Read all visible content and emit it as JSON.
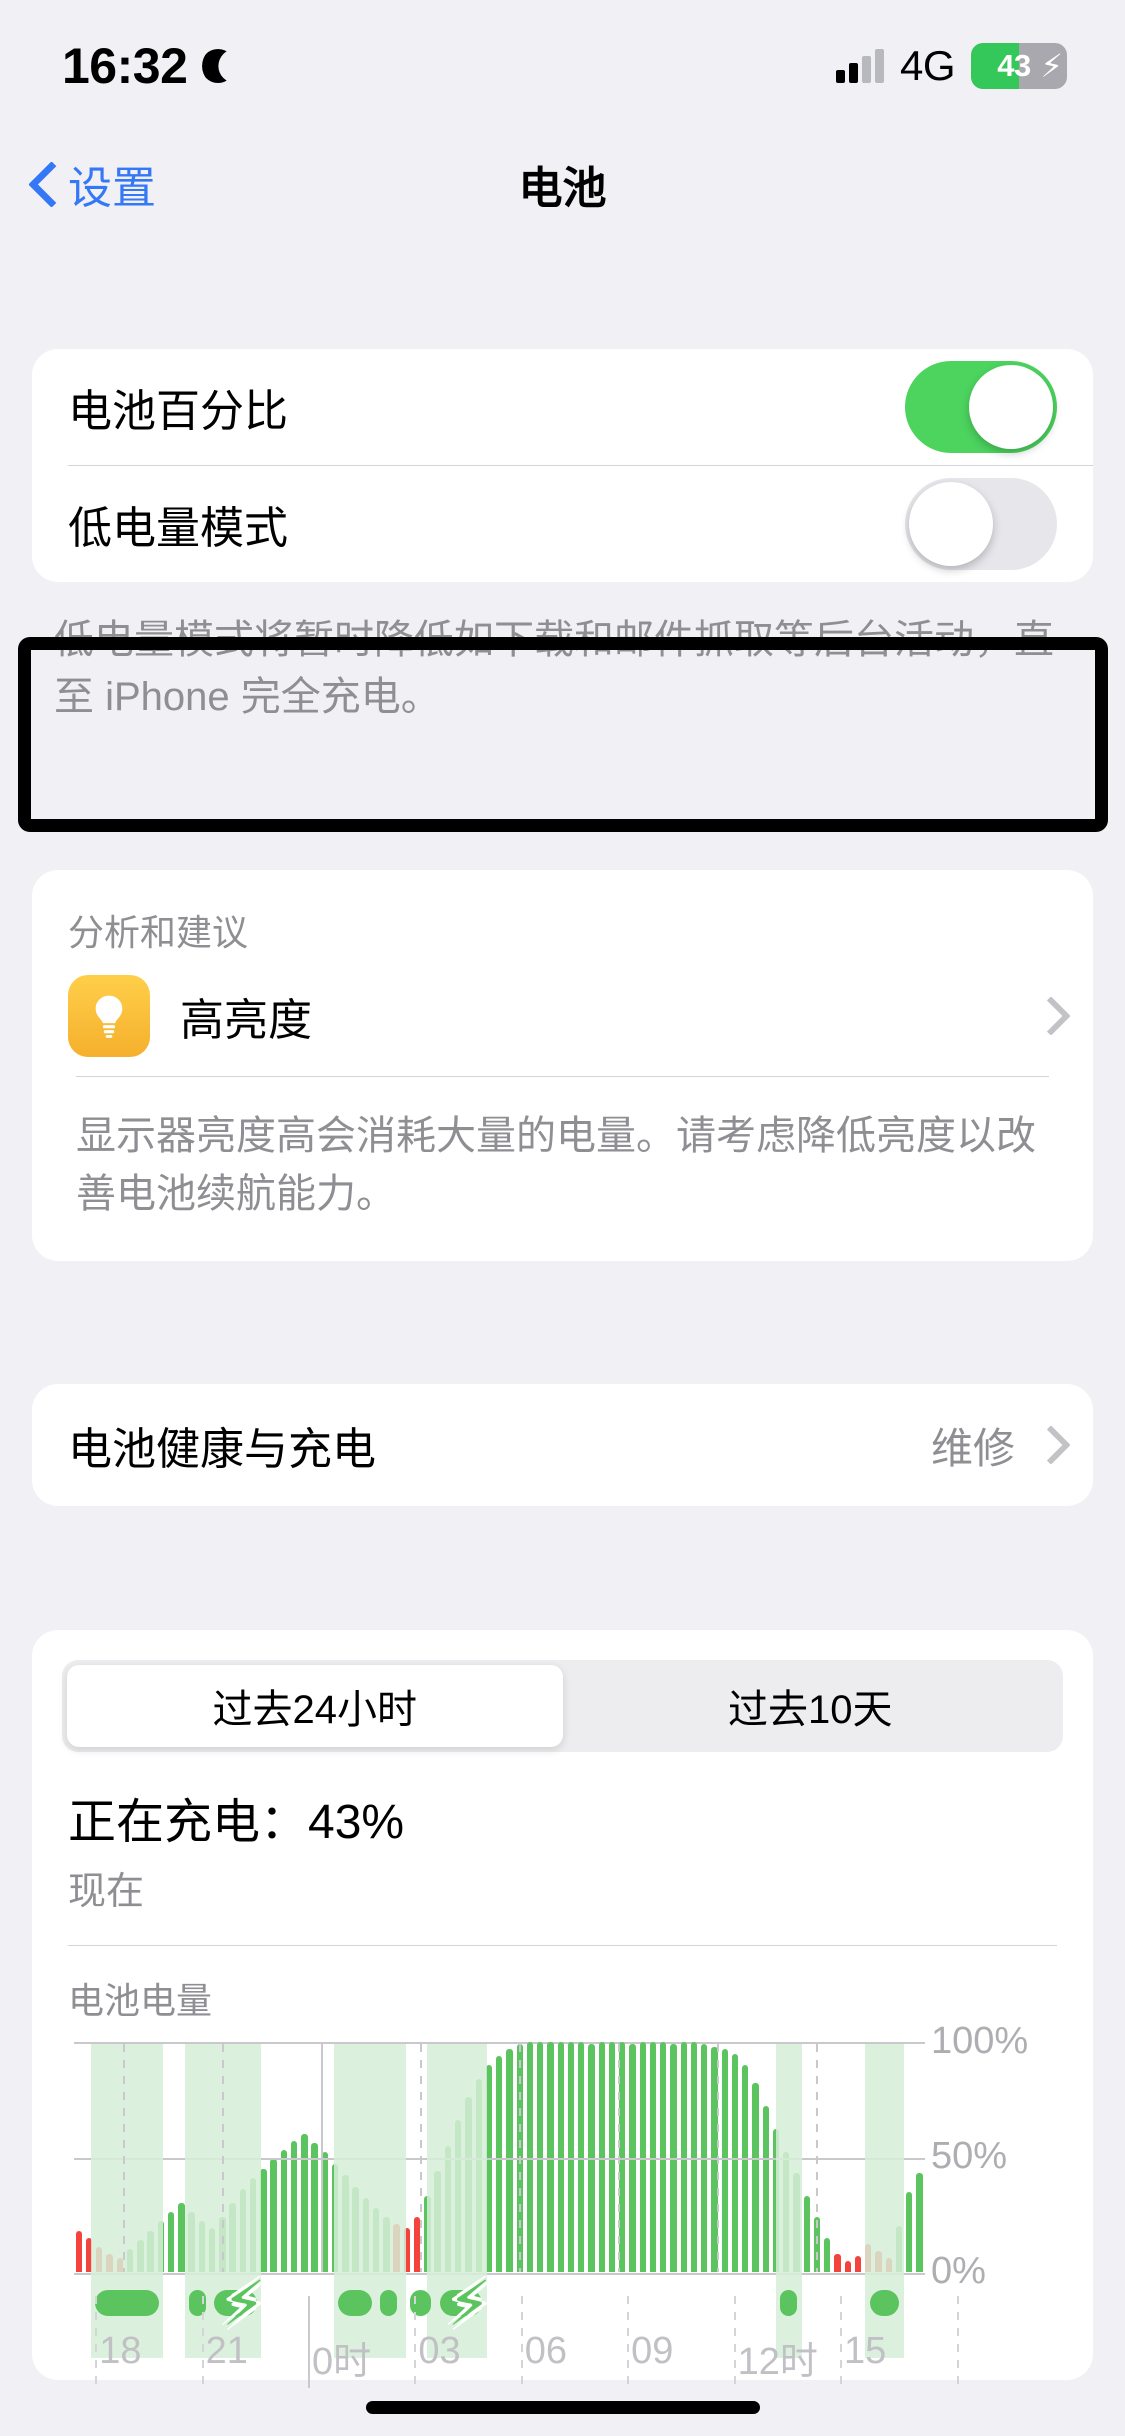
{
  "status_bar": {
    "time": "16:32",
    "moon_icon": "crescent-moon-icon",
    "network": "4G",
    "battery_percent": "43",
    "battery_charging": true,
    "battery_fill_pct": 50,
    "signal_bars_filled": 2,
    "signal_bars_total": 4
  },
  "nav": {
    "back_label": "设置",
    "title": "电池"
  },
  "toggles": {
    "battery_percentage": {
      "label": "电池百分比",
      "state": "on"
    },
    "low_power_mode": {
      "label": "低电量模式",
      "state": "off"
    },
    "footnote": "低电量模式将暂时降低如下载和邮件抓取等后台活动，直至 iPhone 完全充电。"
  },
  "suggestions": {
    "section_title": "分析和建议",
    "item_label": "高亮度",
    "item_icon": "lightbulb-icon",
    "description": "显示器亮度高会消耗大量的电量。请考虑降低亮度以改善电池续航能力。"
  },
  "battery_health": {
    "label": "电池健康与充电",
    "value": "维修"
  },
  "usage": {
    "segments": [
      {
        "label": "过去24小时",
        "selected": true
      },
      {
        "label": "过去10天",
        "selected": false
      }
    ],
    "charge_state": "正在充电：43%",
    "charge_when": "现在",
    "chart_title": "电池电量"
  },
  "colors": {
    "accent_blue": "#3478f6",
    "switch_on_green": "#4cd45f",
    "bar_green": "#5cc45f",
    "bar_red": "#f4433c",
    "charge_band": "#d6efd7",
    "bulb_orange": "#f5b02c",
    "page_bg": "#f0f0f5",
    "card_bg": "#ffffff",
    "secondary_text": "#8e8e93"
  },
  "chart_data": {
    "type": "bar",
    "title": "电池电量",
    "xlabel": "",
    "ylabel": "",
    "ylim": [
      0,
      100
    ],
    "ytick_labels": [
      "100%",
      "50%",
      "0%"
    ],
    "ytick_values": [
      100,
      50,
      0
    ],
    "xtick_labels": [
      "18",
      "21",
      "0时",
      "03",
      "06",
      "09",
      "12时",
      "15"
    ],
    "xtick_hours": [
      18,
      21,
      0,
      3,
      6,
      9,
      12,
      15
    ],
    "grid": true,
    "legend": "none",
    "note": "Battery level percentage sampled every ~15 minutes over the past 24 hours. Red bars indicate low-power (<=20%) periods, green bars normal level. Shaded vertical bands and the pill track below the axis indicate charging intervals.",
    "series": [
      {
        "name": "电池电量",
        "unit": "%",
        "values": [
          18,
          15,
          11,
          8,
          6,
          10,
          14,
          18,
          22,
          26,
          30,
          26,
          22,
          19,
          24,
          30,
          36,
          41,
          45,
          49,
          53,
          57,
          60,
          56,
          52,
          47,
          42,
          37,
          32,
          28,
          24,
          21,
          19,
          24,
          33,
          44,
          55,
          66,
          76,
          84,
          90,
          94,
          97,
          99,
          100,
          100,
          100,
          100,
          100,
          100,
          99,
          100,
          100,
          100,
          99,
          100,
          100,
          100,
          99,
          100,
          100,
          99,
          98,
          97,
          95,
          90,
          82,
          72,
          62,
          52,
          43,
          33,
          24,
          15,
          8,
          5,
          7,
          12,
          9,
          6,
          20,
          35,
          43
        ],
        "colors": [
          "red",
          "red",
          "red",
          "red",
          "red",
          "green",
          "green",
          "green",
          "green",
          "green",
          "green",
          "green",
          "green",
          "green",
          "green",
          "green",
          "green",
          "green",
          "green",
          "green",
          "green",
          "green",
          "green",
          "green",
          "green",
          "green",
          "green",
          "green",
          "green",
          "green",
          "green",
          "red",
          "red",
          "red",
          "green",
          "green",
          "green",
          "green",
          "green",
          "green",
          "green",
          "green",
          "green",
          "green",
          "green",
          "green",
          "green",
          "green",
          "green",
          "green",
          "green",
          "green",
          "green",
          "green",
          "green",
          "green",
          "green",
          "green",
          "green",
          "green",
          "green",
          "green",
          "green",
          "green",
          "green",
          "green",
          "green",
          "green",
          "green",
          "green",
          "green",
          "green",
          "green",
          "green",
          "red",
          "red",
          "red",
          "red",
          "red",
          "red",
          "green",
          "green",
          "green"
        ]
      }
    ],
    "charging_bands": [
      {
        "start_pct": 2.0,
        "end_pct": 10.5
      },
      {
        "start_pct": 13.0,
        "end_pct": 22.0
      },
      {
        "start_pct": 30.5,
        "end_pct": 39.0
      },
      {
        "start_pct": 41.5,
        "end_pct": 48.5
      },
      {
        "start_pct": 82.5,
        "end_pct": 85.5
      },
      {
        "start_pct": 93.0,
        "end_pct": 97.5
      }
    ],
    "charging_pills": [
      {
        "start_pct": 2.5,
        "end_pct": 10.0,
        "bolt": false
      },
      {
        "start_pct": 13.5,
        "end_pct": 15.5,
        "bolt": false
      },
      {
        "start_pct": 16.5,
        "end_pct": 21.5,
        "bolt": true
      },
      {
        "start_pct": 31.0,
        "end_pct": 35.0,
        "bolt": false
      },
      {
        "start_pct": 36.0,
        "end_pct": 38.0,
        "bolt": false
      },
      {
        "start_pct": 39.5,
        "end_pct": 42.0,
        "bolt": false
      },
      {
        "start_pct": 43.0,
        "end_pct": 48.0,
        "bolt": true
      },
      {
        "start_pct": 83.0,
        "end_pct": 85.0,
        "bolt": false
      },
      {
        "start_pct": 93.5,
        "end_pct": 97.0,
        "bolt": false
      }
    ]
  }
}
